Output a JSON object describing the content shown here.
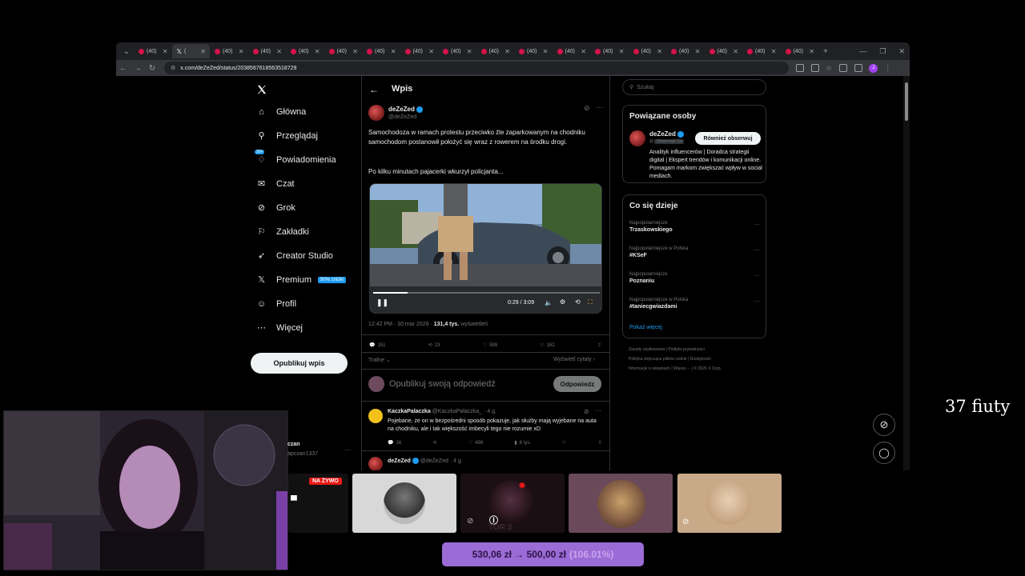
{
  "browser": {
    "tabs": [
      {
        "label": "(40)",
        "active": false
      },
      {
        "label": "(",
        "active": true
      },
      {
        "label": "(40)",
        "active": false
      },
      {
        "label": "(40)",
        "active": false
      },
      {
        "label": "(40)",
        "active": false
      },
      {
        "label": "(40)",
        "active": false
      },
      {
        "label": "(40)",
        "active": false
      },
      {
        "label": "(40)",
        "active": false
      },
      {
        "label": "(40)",
        "active": false
      },
      {
        "label": "(40)",
        "active": false
      },
      {
        "label": "(40)",
        "active": false
      },
      {
        "label": "(40)",
        "active": false
      },
      {
        "label": "(40)",
        "active": false
      },
      {
        "label": "(40)",
        "active": false
      },
      {
        "label": "(40)",
        "active": false
      },
      {
        "label": "(40)",
        "active": false
      },
      {
        "label": "(40)",
        "active": false
      },
      {
        "label": "(40)",
        "active": false
      }
    ],
    "url": "x.com/deZeZed/status/2038567618563518729"
  },
  "nav": {
    "items": [
      {
        "label": "Główna",
        "icon": "home-icon"
      },
      {
        "label": "Przeglądaj",
        "icon": "search-icon"
      },
      {
        "label": "Powiadomienia",
        "icon": "bell-icon",
        "badge": "20+"
      },
      {
        "label": "Czat",
        "icon": "mail-icon"
      },
      {
        "label": "Grok",
        "icon": "grok-icon"
      },
      {
        "label": "Zakładki",
        "icon": "bookmark-icon"
      },
      {
        "label": "Creator Studio",
        "icon": "rocket-icon"
      },
      {
        "label": "Premium",
        "icon": "x-logo-icon",
        "badge": "50% zniżki"
      },
      {
        "label": "Profil",
        "icon": "person-icon"
      },
      {
        "label": "Więcej",
        "icon": "more-icon"
      }
    ],
    "publish": "Opublikuj wpis"
  },
  "post": {
    "header": "Wpis",
    "author": "deZeZed",
    "handle": "@deZeZed",
    "text1": "Samochodoza w ramach protestu przeciwko źle zaparkowanym na chodniku samochodom postanowił położyć się wraz z rowerem na środku drogi.",
    "text2": "Po kilku minutach pajacerki wkurzył policjanta...",
    "video_time": "0:29 / 3:09",
    "video_progress": 0.153,
    "meta_time": "12:42 PM · 30 mar 2026 · ",
    "views": "131,4 tys.",
    "views_label": " wyświetleń",
    "replies": "151",
    "reposts": "23",
    "likes": "599",
    "bookmarks": "162",
    "sort": "Trafne",
    "view_quotes": "Wyświetl cytaty",
    "reply_placeholder": "Opublikuj swoją odpowiedź",
    "reply_button": "Odpowiedz"
  },
  "replies": [
    {
      "author": "KaczkaPalaczka",
      "handle": "@KaczkaPalaczka_ · 4 g.",
      "text": "Pojebane, że on w bezpośredni sposób pokazuje, jak służby mają wyjebane na auta na chodniku, ale i tak większość imbecyli tego nie rozumie xD",
      "replies": "16",
      "likes": "498",
      "views": "8 tys."
    },
    {
      "author": "deZeZed",
      "handle": "@deZeZed · 4 g."
    }
  ],
  "sidebar": {
    "search_placeholder": "Szukaj",
    "who_title": "Powiązane osoby",
    "who_name": "deZeZed",
    "who_handle": "@",
    "who_follows": "Obserwuje Cię",
    "who_button": "Również obserwuj",
    "who_bio": "Analityk influencerów | Doradca strategii digital | Ekspert trendów i komunikacji online. Pomagam markom zwiększać wpływ w social mediach.",
    "trends_title": "Co się dzieje",
    "trends": [
      {
        "cat": "Najpopularniejsze",
        "name": "Trzaskowskiego"
      },
      {
        "cat": "Najpopularniejsze w Polska",
        "name": "#KSeF"
      },
      {
        "cat": "Najpopularniejsze",
        "name": "Poznaniu"
      },
      {
        "cat": "Najpopularniejsze w Polska",
        "name": "#taniecgwiazdami"
      }
    ],
    "show_more": "Pokaż więcej",
    "footer": [
      "Zasady użytkowania",
      "Polityka prywatności",
      "Polityka dotycząca plików cookie",
      "Dostępność",
      "Informacje o reklamach",
      "Więcej ···",
      "© 2026 X Corp."
    ]
  },
  "overlay": {
    "counter": "37 fiuty",
    "live_badge": "NA ŻYWO",
    "partial_name": "czan",
    "partial_handle": "apczan1337",
    "price": "530,06 zł → 500,00 zł",
    "percent": "(106.01%)",
    "ghost_text": "TOR 3"
  },
  "colors": {
    "accent": "#1d9bf0",
    "live": "#e91916",
    "price_bg": "#9b6bd6"
  }
}
